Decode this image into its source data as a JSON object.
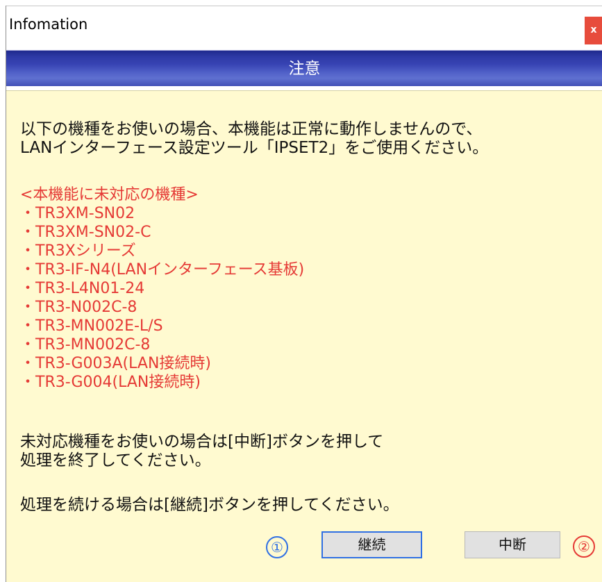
{
  "window": {
    "title": "Infomation",
    "close_label": "x"
  },
  "banner": {
    "title": "注意"
  },
  "message": {
    "intro_line1": "以下の機種をお使いの場合、本機能は正常に動作しませんので、",
    "intro_line2": "LANインターフェース設定ツール「IPSET2」をご使用ください。",
    "models_title": "<本機能に未対応の機種>",
    "models": [
      "・TR3XM-SN02",
      "・TR3XM-SN02-C",
      "・TR3Xシリーズ",
      "・TR3-IF-N4(LANインターフェース基板)",
      "・TR3-L4N01-24",
      "・TR3-N002C-8",
      "・TR3-MN002E-L/S",
      "・TR3-MN002C-8",
      "・TR3-G003A(LAN接続時)",
      "・TR3-G004(LAN接続時)"
    ],
    "cancel_note_line1": "未対応機種をお使いの場合は[中断]ボタンを押して",
    "cancel_note_line2": "処理を終了してください。",
    "continue_note": "処理を続ける場合は[継続]ボタンを押してください。"
  },
  "actions": {
    "continue_badge": "①",
    "continue_label": "継続",
    "cancel_label": "中断",
    "cancel_badge": "②"
  },
  "colors": {
    "accent_blue": "#2f6fe4",
    "warning_red": "#e53935",
    "content_bg": "#fffad0",
    "banner_blue": "#3743b3"
  }
}
